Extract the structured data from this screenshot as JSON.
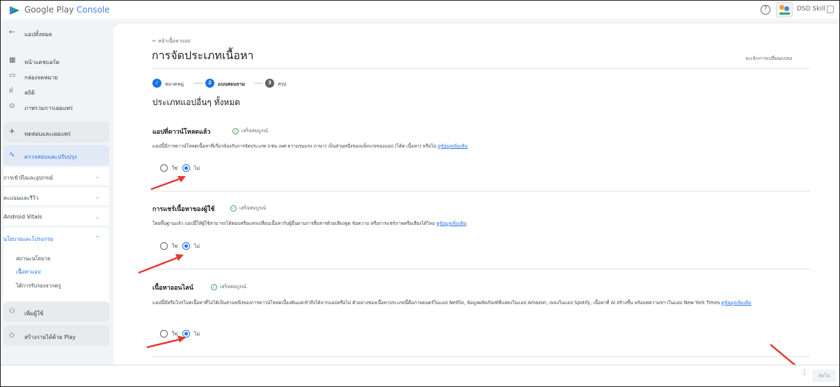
{
  "header": {
    "brand_google": "Google Play",
    "brand_console": "Console",
    "help_icon": "question-circle-icon",
    "account_name": "DSD Skill"
  },
  "sidebar": {
    "back": "แอปทั้งหมด",
    "items": [
      {
        "label": "หน้าแดชบอร์ด",
        "icon": "dashboard-icon"
      },
      {
        "label": "กล่องจดหมาย",
        "icon": "inbox-icon"
      },
      {
        "label": "สถิติ",
        "icon": "bar-chart-icon"
      },
      {
        "label": "ภาพรวมการเผยแพร่",
        "icon": "publishing-icon"
      }
    ],
    "test_release": "ทดสอบและเผยแพร่",
    "monitor_improve": "ตรวจสอบและปรับปรุง",
    "sections": [
      {
        "label": "การเข้าถึงและอุปกรณ์"
      },
      {
        "label": "คะแนนและรีวิว"
      },
      {
        "label": "Android Vitals"
      },
      {
        "label": "นโยบายและโปรแกรม"
      }
    ],
    "policy_sub": [
      "สถานะนโยบาย",
      "เนื้อหาแอป",
      "ได้การรับรองจากครู"
    ],
    "grow_users": "เพิ่มผู้ใช้",
    "monetize": "สร้างรายได้ด้วย Play"
  },
  "main": {
    "back_link": "← หน้าเนื้อหาแอป",
    "title": "การจัดประเภทเนื้อหา",
    "discard": "ละเลิกการเปลี่ยนแปลง",
    "steps": [
      {
        "num": "✓",
        "label": "หมวดหมู่"
      },
      {
        "num": "2",
        "label": "แบบสอบถาม"
      },
      {
        "num": "3",
        "label": "สรุป"
      }
    ],
    "section_title": "ประเภทแอปอื่นๆ ทั้งหมด",
    "questions": [
      {
        "title": "แอปที่ดาวน์โหลดแล้ว",
        "status": "เสร็จสมบูรณ์",
        "desc": "แอปนี้มีการดาวน์โหลดเนื้อหาที่เกี่ยวข้องกับการจัดประเภท (เช่น เพศ ความรุนแรง ภาษา) เป็นส่วนหนึ่งของแพ็กเกจของแอป (โค้ด เนื้อหา) หรือไม่",
        "link": "ดูข้อมูลเพิ่มเติม",
        "yes": "ใช่",
        "no": "ไม่"
      },
      {
        "title": "การแชร์เนื้อหาของผู้ใช้",
        "status": "เสร็จสมบูรณ์",
        "desc": "โดยพื้นฐานแล้ว แอปนี้ให้ผู้ใช้สามารถโต้ตอบหรือแลกเปลี่ยนเนื้อหากับผู้อื่นผ่านการสื่อสารด้วยเสียงพูด ข้อความ หรือการแชร์ภาพหรือเสียงได้ไหม",
        "link": "ดูข้อมูลเพิ่มเติม",
        "yes": "ใช่",
        "no": "ไม่"
      },
      {
        "title": "เนื้อหาออนไลน์",
        "status": "เสร็จสมบูรณ์",
        "desc": "แอปนี้มีหรือโปรโมตเนื้อหาที่ไม่ได้เป็นส่วนหนึ่งของการดาวน์โหลดเบื้องต้นแต่เข้าถึงได้จากแอปหรือไม่ ตัวอย่างของเนื้อหาประเภทนี้คือภาพยนตร์ในแอป Netflix, ข้อมูลผลิตภัณฑ์ที่แสดงในแอป Amazon, เพลงในแอป Spotify, เนื้อหาที่ AI สร้างขึ้น พร้อมทความข่าวในแอป New York Times",
        "link": "ดูข้อมูลเพิ่มเติม",
        "yes": "ใช่",
        "no": "ไม่"
      }
    ]
  },
  "footer": {
    "next": "ถัดไป",
    "more_icon": "more-vert-icon"
  },
  "colors": {
    "accent": "#1a73e8",
    "success": "#34a853",
    "annotation_arrow": "#e53935"
  }
}
